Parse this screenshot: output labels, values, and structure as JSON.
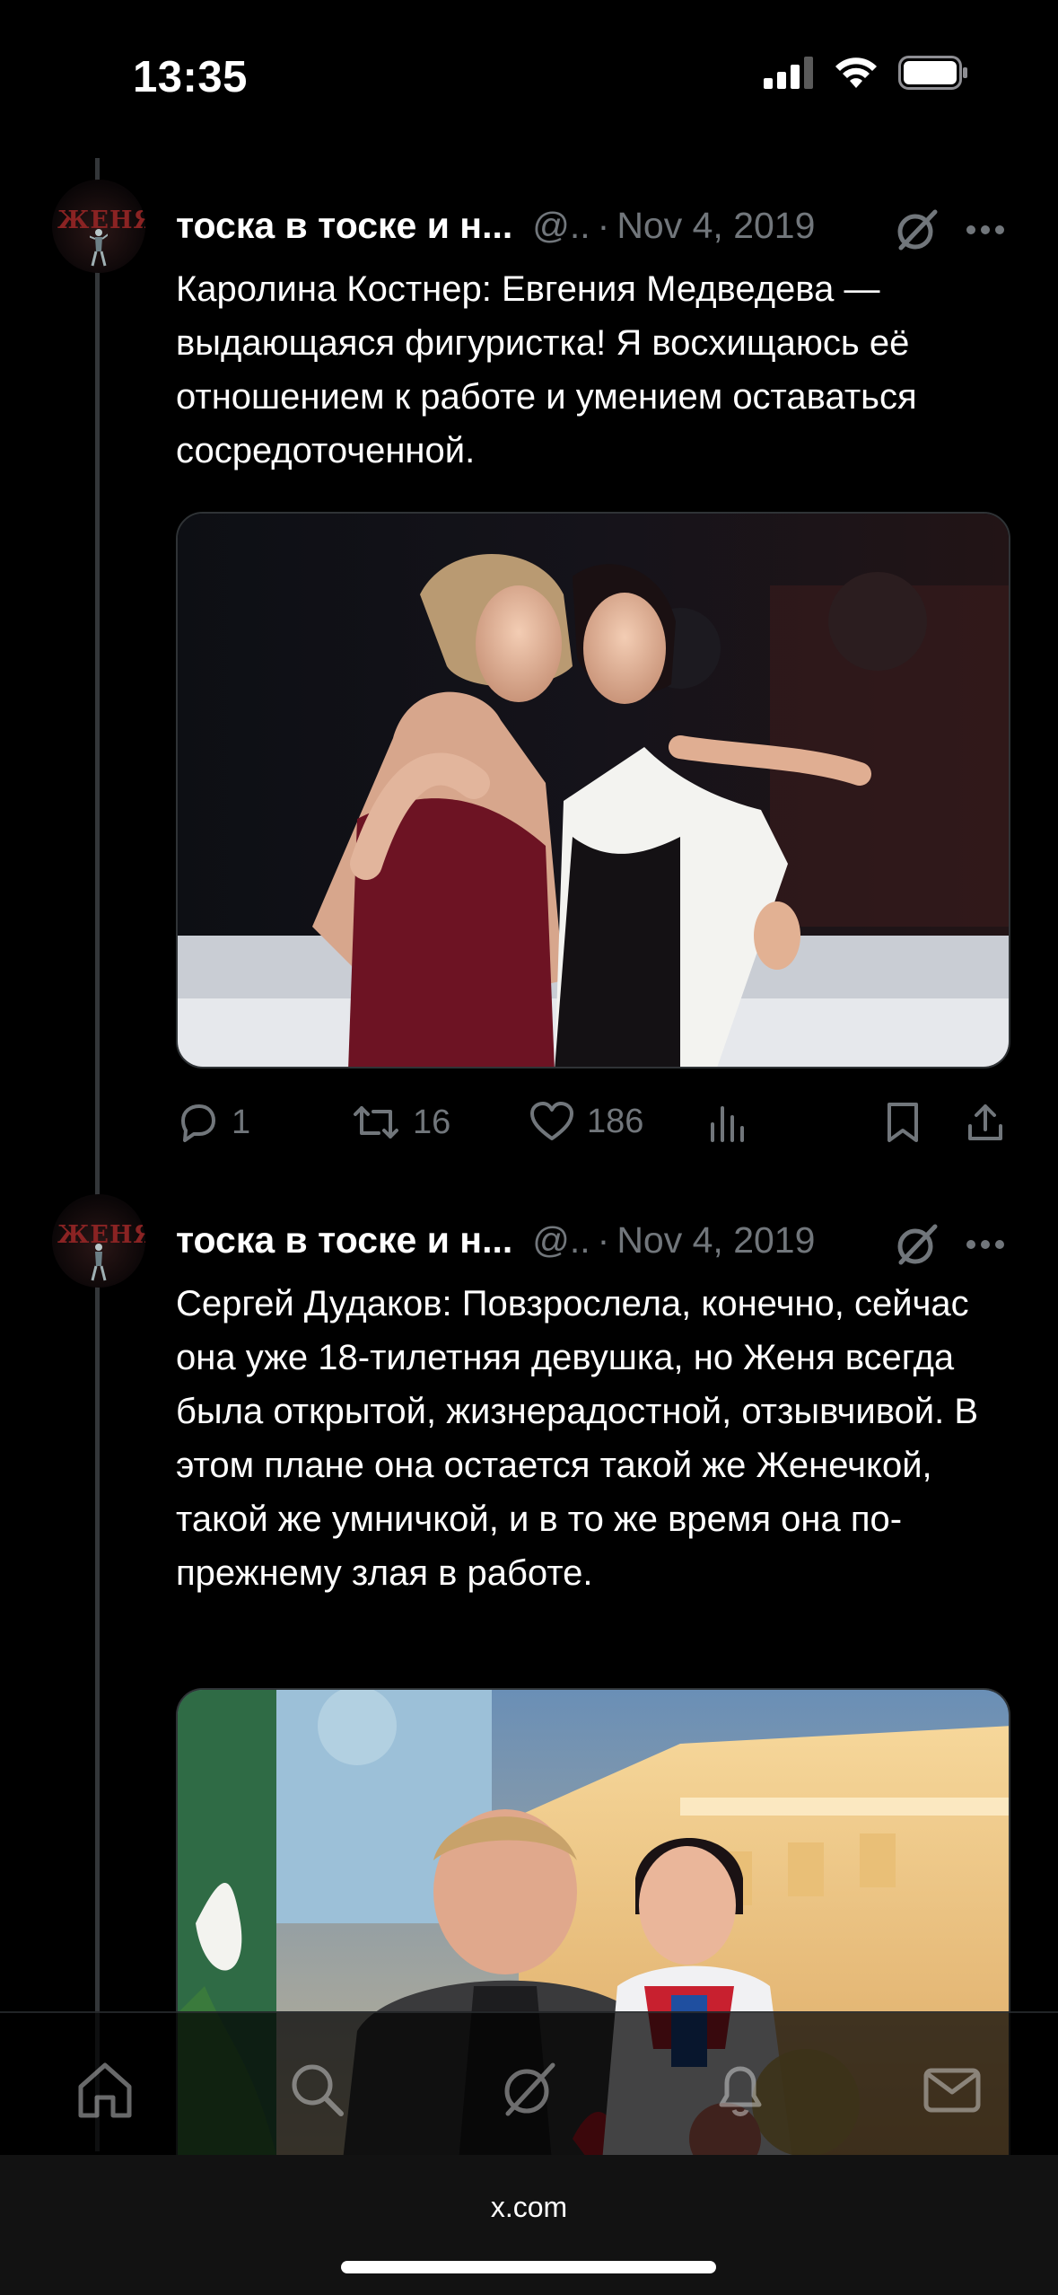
{
  "status_bar": {
    "time": "13:35"
  },
  "tweets": [
    {
      "avatar_text": "ЖЕНЯ",
      "name": "тоска в тоске и н...",
      "handle": "@..",
      "separator": "·",
      "date": "Nov 4, 2019",
      "text": "Каролина Костнер: Евгения Медведева — выдающаяся фигуристка! Я восхищаюсь её отношением к работе и умением оставаться сосредоточенной.",
      "actions": {
        "replies": "1",
        "reposts": "16",
        "likes": "186"
      }
    },
    {
      "avatar_text": "ЖЕНЯ",
      "name": "тоска в тоске и н...",
      "handle": "@..",
      "separator": "·",
      "date": "Nov 4, 2019",
      "text": "Сергей Дудаков: Повзрослела, конечно, сейчас она уже 18-тилетняя девушка, но Женя всегда была открытой, жизнерадостной, отзывчивой. В этом плане она остается такой же Женечкой, такой же умничкой, и в то же время она по-прежнему злая в работе."
    }
  ],
  "browser": {
    "url": "x.com"
  },
  "colors": {
    "background": "#000000",
    "secondary_text": "#71767b",
    "primary_text": "#ffffff"
  },
  "icons": [
    "reply-icon",
    "repost-icon",
    "like-icon",
    "views-icon",
    "bookmark-icon",
    "share-icon",
    "grok-icon",
    "more-icon",
    "home-icon",
    "search-icon",
    "grok-nav-icon",
    "notifications-icon",
    "messages-icon"
  ]
}
